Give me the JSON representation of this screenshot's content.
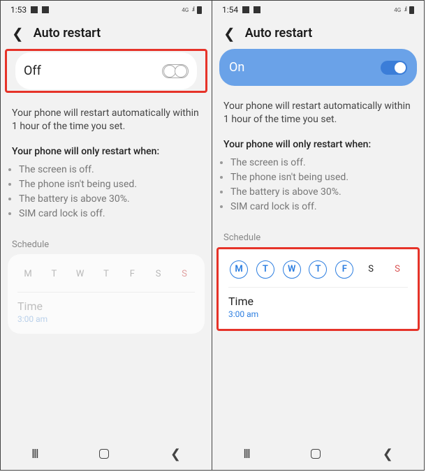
{
  "left": {
    "statusbar": {
      "time": "1:53",
      "net": "4G"
    },
    "header": {
      "title": "Auto restart"
    },
    "toggle": {
      "label": "Off",
      "state": "off"
    },
    "description": "Your phone will restart automatically within 1 hour of the time you set.",
    "conditions_heading": "Your phone will only restart when:",
    "conditions": [
      "The screen is off.",
      "The phone isn't being used.",
      "The battery is above 30%.",
      "SIM card lock is off."
    ],
    "schedule_label": "Schedule",
    "days": [
      {
        "letter": "M",
        "selected": false,
        "sunday": false
      },
      {
        "letter": "T",
        "selected": false,
        "sunday": false
      },
      {
        "letter": "W",
        "selected": false,
        "sunday": false
      },
      {
        "letter": "T",
        "selected": false,
        "sunday": false
      },
      {
        "letter": "F",
        "selected": false,
        "sunday": false
      },
      {
        "letter": "S",
        "selected": false,
        "sunday": false
      },
      {
        "letter": "S",
        "selected": false,
        "sunday": true
      }
    ],
    "time": {
      "label": "Time",
      "value": "3:00 am"
    }
  },
  "right": {
    "statusbar": {
      "time": "1:54",
      "net": "4G"
    },
    "header": {
      "title": "Auto restart"
    },
    "toggle": {
      "label": "On",
      "state": "on"
    },
    "description": "Your phone will restart automatically within 1 hour of the time you set.",
    "conditions_heading": "Your phone will only restart when:",
    "conditions": [
      "The screen is off.",
      "The phone isn't being used.",
      "The battery is above 30%.",
      "SIM card lock is off."
    ],
    "schedule_label": "Schedule",
    "days": [
      {
        "letter": "M",
        "selected": true,
        "sunday": false
      },
      {
        "letter": "T",
        "selected": true,
        "sunday": false
      },
      {
        "letter": "W",
        "selected": true,
        "sunday": false
      },
      {
        "letter": "T",
        "selected": true,
        "sunday": false
      },
      {
        "letter": "F",
        "selected": true,
        "sunday": false
      },
      {
        "letter": "S",
        "selected": false,
        "sunday": false
      },
      {
        "letter": "S",
        "selected": false,
        "sunday": true
      }
    ],
    "time": {
      "label": "Time",
      "value": "3:00 am"
    }
  }
}
